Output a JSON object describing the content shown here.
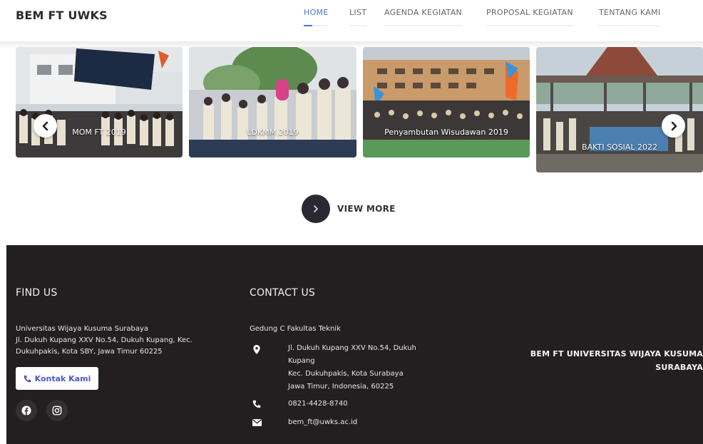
{
  "header": {
    "brand": "BEM FT UWKS",
    "nav": [
      {
        "label": "HOME",
        "active": true
      },
      {
        "label": "LIST",
        "active": false
      },
      {
        "label": "AGENDA KEGIATAN",
        "active": false
      },
      {
        "label": "PROPOSAL KEGIATAN",
        "active": false
      },
      {
        "label": "TENTANG KAMI",
        "active": false
      }
    ]
  },
  "carousel": {
    "prev_icon": "chevron-left-icon",
    "next_icon": "chevron-right-icon",
    "items": [
      {
        "caption": "MOM FT 2019"
      },
      {
        "caption": "LDKMM 2019"
      },
      {
        "caption": "Penyambutan Wisudawan 2019"
      },
      {
        "caption": "BAKTI SOSIAL 2022"
      }
    ]
  },
  "view_more": {
    "label": "VIEW MORE",
    "icon": "chevron-right-icon"
  },
  "footer": {
    "find_us": {
      "title": "FIND US",
      "address_lines": [
        "Universitas Wijaya Kusuma Surabaya",
        "Jl. Dukuh Kupang XXV No.54, Dukuh Kupang, Kec.",
        "Dukuhpakis, Kota SBY, Jawa Timur 60225"
      ],
      "contact_button": "Kontak Kami",
      "social_icons": [
        "facebook-icon",
        "instagram-icon"
      ]
    },
    "contact_us": {
      "title": "CONTACT US",
      "building": "Gedung C Fakultas Teknik",
      "address_lines": [
        "Jl. Dukuh Kupang XXV No.54, Dukuh",
        "Kupang",
        "Kec. Dukuhpakis, Kota Surabaya",
        "Jawa Timur, Indonesia, 60225"
      ],
      "phone": "0821-4428-8740",
      "email": "bem_ft@uwks.ac.id"
    },
    "org_name_lines": [
      "BEM FT UNIVERSITAS WIJAYA KUSUMA",
      "SURABAYA"
    ]
  },
  "colors": {
    "accent": "#4e73df",
    "footer_bg": "#231f20",
    "button_dark": "#2a2833"
  }
}
